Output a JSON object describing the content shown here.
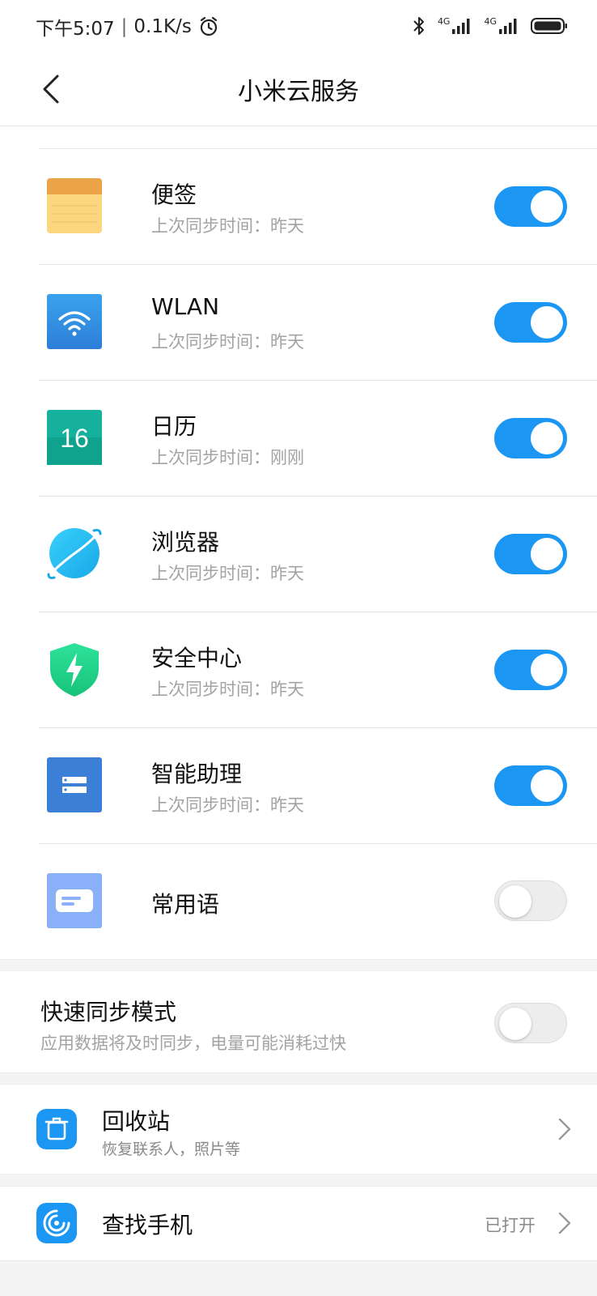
{
  "status_bar": {
    "time": "下午5:07",
    "separator": "|",
    "speed": "0.1K/s",
    "network_1": "4G",
    "network_2": "4G"
  },
  "header": {
    "title": "小米云服务"
  },
  "sync_items": [
    {
      "name": "便签",
      "subtitle": "上次同步时间：昨天",
      "enabled": true,
      "icon": "notes-icon"
    },
    {
      "name": "WLAN",
      "subtitle": "上次同步时间：昨天",
      "enabled": true,
      "icon": "wifi-icon"
    },
    {
      "name": "日历",
      "subtitle": "上次同步时间：刚刚",
      "enabled": true,
      "icon": "calendar-icon",
      "icon_text": "16"
    },
    {
      "name": "浏览器",
      "subtitle": "上次同步时间：昨天",
      "enabled": true,
      "icon": "browser-icon"
    },
    {
      "name": "安全中心",
      "subtitle": "上次同步时间：昨天",
      "enabled": true,
      "icon": "security-icon"
    },
    {
      "name": "智能助理",
      "subtitle": "上次同步时间：昨天",
      "enabled": true,
      "icon": "assistant-icon"
    },
    {
      "name": "常用语",
      "subtitle": "",
      "enabled": false,
      "icon": "phrases-icon"
    }
  ],
  "fast_sync": {
    "title": "快速同步模式",
    "subtitle": "应用数据将及时同步，电量可能消耗过快",
    "enabled": false
  },
  "recycle_bin": {
    "title": "回收站",
    "subtitle": "恢复联系人，照片等",
    "icon": "trash-icon"
  },
  "find_phone": {
    "title": "查找手机",
    "status": "已打开",
    "icon": "radar-icon"
  },
  "colors": {
    "accent": "#1b97f3",
    "toggle_off": "#ededed",
    "subtitle": "#a3a3a3"
  }
}
